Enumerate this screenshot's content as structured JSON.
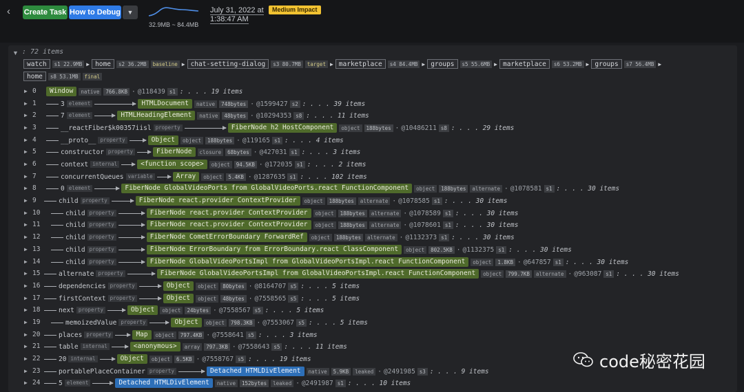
{
  "topbar": {
    "back_icon": "chevron-left-icon",
    "create_label": "Create Task",
    "debug_label": "How to Debug",
    "menu_icon": "caret-down-icon",
    "memory_range": "32.9MB ~ 84.4MB",
    "date_line1": "July 31, 2022 at",
    "date_line2": "1:38:47 AM",
    "impact_label": "Medium Impact",
    "colors": {
      "create": "#2e8b3e",
      "debug": "#2f7be6",
      "impact": "#f1c232",
      "node": "#4f6a2b",
      "detached": "#2d6fb8"
    }
  },
  "root": {
    "label": ": 72 items"
  },
  "path": {
    "row1": [
      {
        "name": "watch",
        "dist": "s1 22.9MB"
      },
      {
        "name": "home",
        "dist": "s2 36.2MB",
        "tag": "baseline"
      },
      {
        "name": "chat-setting-dialog",
        "dist": "s3 80.7MB",
        "tag": "target"
      },
      {
        "name": "marketplace",
        "dist": "s4 84.4MB"
      },
      {
        "name": "groups",
        "dist": "s5 55.6MB"
      },
      {
        "name": "marketplace",
        "dist": "s6 53.2MB"
      },
      {
        "name": "groups",
        "dist": "s7 56.4MB"
      }
    ],
    "row2": [
      {
        "name": "home",
        "dist": "s8 53.1MB",
        "tag": "final"
      }
    ]
  },
  "rows": [
    {
      "idx": "0",
      "edge": "",
      "etype": "",
      "node": "Window",
      "ntype": "native",
      "size": "766.8KB",
      "flag": "",
      "id": "@118439",
      "dist": "s1",
      "count": ": . . . 19 items"
    },
    {
      "idx": "1",
      "edge": "3",
      "etype": "element",
      "node": "HTMLDocument",
      "ntype": "native",
      "size": "748bytes",
      "flag": "",
      "id": "@1599427",
      "dist": "s2",
      "count": ": . . . 39 items"
    },
    {
      "idx": "2",
      "edge": "7",
      "etype": "element",
      "node": "HTMLHeadingElement",
      "ntype": "native",
      "size": "48bytes",
      "flag": "",
      "id": "@10294353",
      "dist": "s8",
      "count": ": . . . 11 items"
    },
    {
      "idx": "3",
      "edge": "__reactFiber$k00357iisl",
      "etype": "property",
      "node": "FiberNode h2 HostComponent",
      "ntype": "object",
      "size": "188bytes",
      "flag": "",
      "id": "@10486211",
      "dist": "s8",
      "count": ": . . . 29 items"
    },
    {
      "idx": "4",
      "edge": "__proto__",
      "etype": "property",
      "node": "Object",
      "ntype": "object",
      "size": "188bytes",
      "flag": "",
      "id": "@119165",
      "dist": "s1",
      "count": ": . . . 4 items"
    },
    {
      "idx": "5",
      "edge": "constructor",
      "etype": "property",
      "node": "FiberNode",
      "ntype": "closure",
      "size": "68bytes",
      "flag": "",
      "id": "@427031",
      "dist": "s1",
      "count": ": . . . 3 items"
    },
    {
      "idx": "6",
      "edge": "context",
      "etype": "internal",
      "node": "<function scope>",
      "ntype": "object",
      "size": "94.5KB",
      "flag": "",
      "id": "@172035",
      "dist": "s1",
      "count": ": . . . 2 items"
    },
    {
      "idx": "7",
      "edge": "concurrentQueues",
      "etype": "variable",
      "node": "Array",
      "ntype": "object",
      "size": "5.4KB",
      "flag": "",
      "id": "@1287635",
      "dist": "s1",
      "count": ": . . . 102 items"
    },
    {
      "idx": "8",
      "edge": "0",
      "etype": "element",
      "node": "FiberNode GlobalVideoPorts from GlobalVideoPorts.react FunctionComponent",
      "ntype": "object",
      "size": "188bytes",
      "flag": "alternate",
      "id": "@1078581",
      "dist": "s1",
      "count": ": . . . 30 items"
    },
    {
      "idx": "9",
      "edge": "child",
      "etype": "property",
      "node": "FiberNode react.provider ContextProvider",
      "ntype": "object",
      "size": "188bytes",
      "flag": "alternate",
      "id": "@1078585",
      "dist": "s1",
      "count": ": . . . 30 items"
    },
    {
      "idx": "10",
      "edge": "child",
      "etype": "property",
      "node": "FiberNode react.provider ContextProvider",
      "ntype": "object",
      "size": "188bytes",
      "flag": "alternate",
      "id": "@1078589",
      "dist": "s1",
      "count": ": . . . 30 items"
    },
    {
      "idx": "11",
      "edge": "child",
      "etype": "property",
      "node": "FiberNode react.provider ContextProvider",
      "ntype": "object",
      "size": "188bytes",
      "flag": "alternate",
      "id": "@1078601",
      "dist": "s1",
      "count": ": . . . 30 items"
    },
    {
      "idx": "12",
      "edge": "child",
      "etype": "property",
      "node": "FiberNode CometErrorBoundary ForwardRef",
      "ntype": "object",
      "size": "188bytes",
      "flag": "alternate",
      "id": "@1132373",
      "dist": "s1",
      "count": ": . . . 30 items"
    },
    {
      "idx": "13",
      "edge": "child",
      "etype": "property",
      "node": "FiberNode ErrorBoundary from ErrorBoundary.react ClassComponent",
      "ntype": "object",
      "size": "802.5KB",
      "flag": "",
      "id": "@1132375",
      "dist": "s1",
      "count": ": . . . 30 items"
    },
    {
      "idx": "14",
      "edge": "child",
      "etype": "property",
      "node": "FiberNode GlobalVideoPortsImpl from GlobalVideoPortsImpl.react FunctionComponent",
      "ntype": "object",
      "size": "1.8KB",
      "flag": "",
      "id": "@647857",
      "dist": "s1",
      "count": ": . . . 30 items"
    },
    {
      "idx": "15",
      "edge": "alternate",
      "etype": "property",
      "node": "FiberNode GlobalVideoPortsImpl from GlobalVideoPortsImpl.react FunctionComponent",
      "ntype": "object",
      "size": "799.7KB",
      "flag": "alternate",
      "id": "@963087",
      "dist": "s1",
      "count": ": . . . 30 items"
    },
    {
      "idx": "16",
      "edge": "dependencies",
      "etype": "property",
      "node": "Object",
      "ntype": "object",
      "size": "80bytes",
      "flag": "",
      "id": "@8164707",
      "dist": "s5",
      "count": ": . . . 5 items"
    },
    {
      "idx": "17",
      "edge": "firstContext",
      "etype": "property",
      "node": "Object",
      "ntype": "object",
      "size": "48bytes",
      "flag": "",
      "id": "@7558565",
      "dist": "s5",
      "count": ": . . . 5 items"
    },
    {
      "idx": "18",
      "edge": "next",
      "etype": "property",
      "node": "Object",
      "ntype": "object",
      "size": "24bytes",
      "flag": "",
      "id": "@7558567",
      "dist": "s5",
      "count": ": . . . 5 items"
    },
    {
      "idx": "19",
      "edge": "memoizedValue",
      "etype": "property",
      "node": "Object",
      "ntype": "object",
      "size": "798.3KB",
      "flag": "",
      "id": "@7553067",
      "dist": "s5",
      "count": ": . . . 5 items"
    },
    {
      "idx": "20",
      "edge": "places",
      "etype": "property",
      "node": "Map",
      "ntype": "object",
      "size": "797.4KB",
      "flag": "",
      "id": "@7558641",
      "dist": "s5",
      "count": ": . . . 3 items"
    },
    {
      "idx": "21",
      "edge": "table",
      "etype": "internal",
      "node": "<anonymous>",
      "ntype": "array",
      "size": "797.3KB",
      "flag": "",
      "id": "@7558643",
      "dist": "s5",
      "count": ": . . . 11 items"
    },
    {
      "idx": "22",
      "edge": "20",
      "etype": "internal",
      "node": "Object",
      "ntype": "object",
      "size": "6.5KB",
      "flag": "",
      "id": "@7558767",
      "dist": "s5",
      "count": ": . . . 19 items"
    },
    {
      "idx": "23",
      "edge": "portablePlaceContainer",
      "etype": "property",
      "node": "Detached HTMLDivElement",
      "ntype": "native",
      "size": "5.9KB",
      "flag": "leaked",
      "id": "@2491985",
      "dist": "s3",
      "count": ": . . . 9 items"
    },
    {
      "idx": "24",
      "edge": "5",
      "etype": "element",
      "node": "Detached HTMLDivElement",
      "ntype": "native",
      "size": "152bytes",
      "flag": "leaked",
      "id": "@2491987",
      "dist": "s1",
      "count": ": . . . 10 items"
    }
  ],
  "watermark": {
    "icon": "wechat-icon",
    "text": "code秘密花园"
  }
}
